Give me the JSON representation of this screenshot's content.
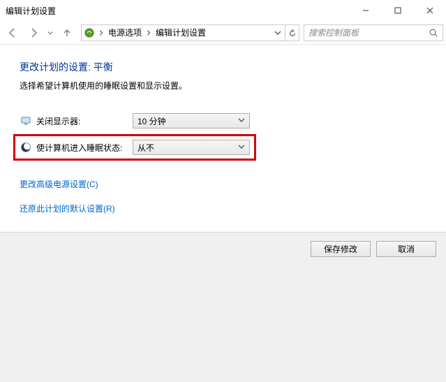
{
  "window": {
    "title": "编辑计划设置"
  },
  "breadcrumb": {
    "items": [
      "电源选项",
      "编辑计划设置"
    ]
  },
  "search": {
    "placeholder": "搜索控制面板"
  },
  "page": {
    "heading": "更改计划的设置: 平衡",
    "subtext": "选择希望计算机使用的睡眠设置和显示设置。"
  },
  "settings": {
    "display_off": {
      "label": "关闭显示器:",
      "value": "10 分钟"
    },
    "sleep": {
      "label": "使计算机进入睡眠状态:",
      "value": "从不"
    }
  },
  "links": {
    "advanced": "更改高级电源设置(C)",
    "restore": "还原此计划的默认设置(R)"
  },
  "buttons": {
    "save": "保存修改",
    "cancel": "取消"
  }
}
